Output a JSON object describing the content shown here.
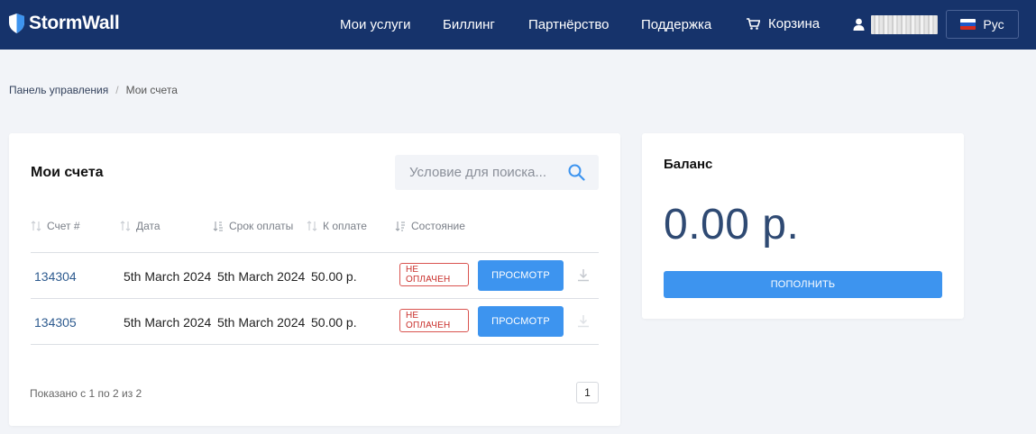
{
  "header": {
    "brand": "StormWall",
    "nav": [
      "Мои услуги",
      "Биллинг",
      "Партнёрство",
      "Поддержка"
    ],
    "cart_label": "Корзина",
    "language": "Рус",
    "colors": {
      "header_bg": "#16336b",
      "accent": "#3d94ef"
    }
  },
  "breadcrumb": {
    "home": "Панель управления",
    "separator": "/",
    "current": "Мои счета"
  },
  "invoices": {
    "title": "Мои счета",
    "search_placeholder": "Условие для поиска...",
    "columns": [
      "Счет #",
      "Дата",
      "Срок оплаты",
      "К оплате",
      "Состояние"
    ],
    "rows": [
      {
        "id": "134304",
        "date": "5th March 2024",
        "due": "5th March 2024",
        "amount": "50.00 р.",
        "status": "НЕ ОПЛАЧЕН",
        "action": "ПРОСМОТР"
      },
      {
        "id": "134305",
        "date": "5th March 2024",
        "due": "5th March 2024",
        "amount": "50.00 р.",
        "status": "НЕ ОПЛАЧЕН",
        "action": "ПРОСМОТР"
      }
    ],
    "summary": "Показано с 1 по 2 из 2",
    "page": "1"
  },
  "balance": {
    "title": "Баланс",
    "amount": "0.00 р.",
    "topup_label": "ПОПОЛНИТЬ"
  }
}
